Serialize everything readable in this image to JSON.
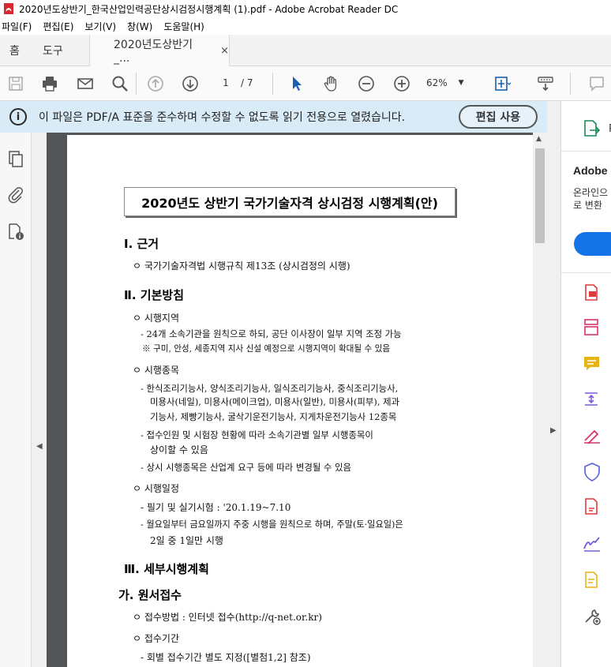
{
  "window": {
    "title": "2020년도상반기_한국산업인력공단상시검정시행계획 (1).pdf - Adobe Acrobat Reader DC"
  },
  "menu": [
    "파일(F)",
    "편집(E)",
    "보기(V)",
    "창(W)",
    "도움말(H)"
  ],
  "tabs": {
    "home": "홈",
    "tools": "도구",
    "doc": "2020년도상반기_...",
    "close": "×"
  },
  "toolbar": {
    "page_current": "1",
    "page_total": "/ 7",
    "zoom": "62%"
  },
  "infobar": {
    "message": "이 파일은 PDF/A 표준을 준수하며 수정할 수 없도록 읽기 전용으로 열렸습니다.",
    "button": "편집 사용"
  },
  "rightpanel": {
    "export_label": "P",
    "adobe_title": "Adobe",
    "adobe_desc1": "온라인으",
    "adobe_desc2": "로 변환"
  },
  "document": {
    "title": "2020년도 상반기 국가기술자격 상시검정 시행계획(안)",
    "sec1": "Ⅰ. 근거",
    "sec1_item": "ㅇ  국가기술자격법 시행규칙 제13조 (상시검정의 시행)",
    "sec2": "Ⅱ. 기본방침",
    "s2_a": "ㅇ  시행지역",
    "s2_a1": "- 24개 소속기관을 원칙으로 하되, 공단 이사장이 일부 지역 조정 가능",
    "s2_a2": "※ 구미, 안성, 세종지역 지사 신설 예정으로 시행지역이 확대될 수 있음",
    "s2_b": "ㅇ  시행종목",
    "s2_b1": "- 한식조리기능사, 양식조리기능사, 일식조리기능사, 중식조리기능사,",
    "s2_b2": "미용사(네일), 미용사(메이크업), 미용사(일반), 미용사(피부), 제과",
    "s2_b3": "기능사, 제빵기능사, 굴삭기운전기능사, 지게차운전기능사 12종목",
    "s2_b4": "- 접수인원 및 시험장 현황에 따라 소속기관별 일부 시행종목이",
    "s2_b5": "상이할 수 있음",
    "s2_b6": "- 상시 시행종목은 산업계 요구 등에 따라 변경될 수 있음",
    "s2_c": "ㅇ  시행일정",
    "s2_c1": "- 필기 및 실기시험 : '20.1.19~7.10",
    "s2_c2": "- 월요일부터 금요일까지 주중 시행을 원칙으로 하며, 주말(토·일요일)은",
    "s2_c3": "2일 중 1일만 시행",
    "sec3": "Ⅲ. 세부시행계획",
    "sec3a": "가. 원서접수",
    "s3_a": "ㅇ  접수방법 : 인터넷 접수(http://q-net.or.kr)",
    "s3_b": "ㅇ  접수기간",
    "s3_b1": "- 회별 접수기간 별도 지정([별첨1,2] 참조)"
  }
}
